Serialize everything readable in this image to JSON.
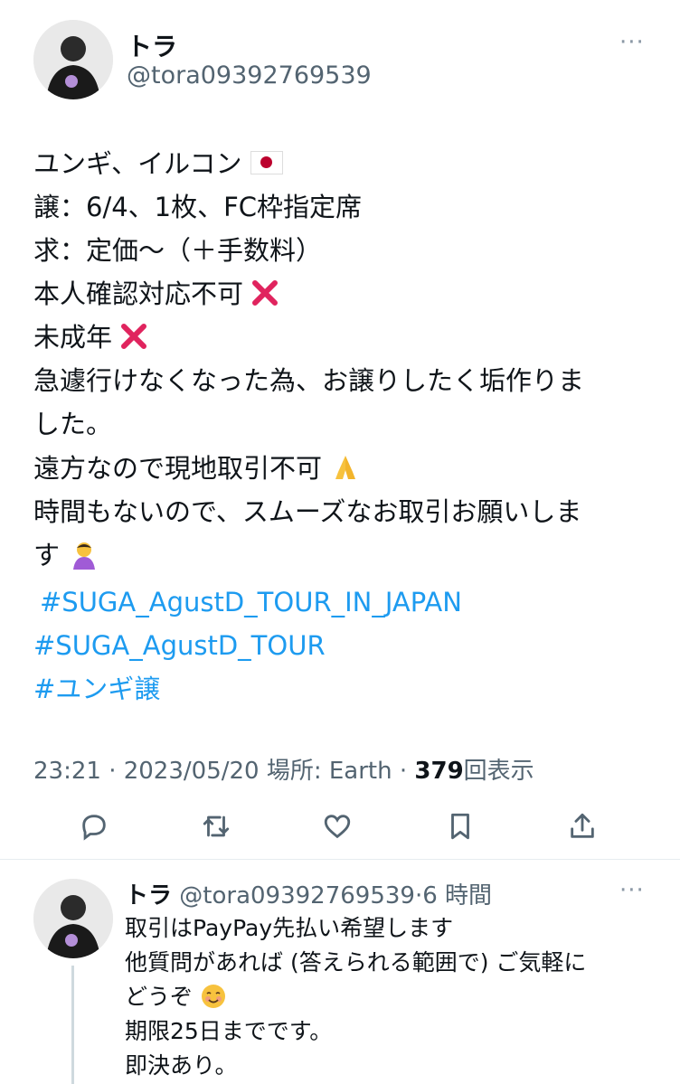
{
  "tweet": {
    "display_name": "トラ",
    "handle": "@tora09392769539",
    "lines": [
      "ユンギ、イルコン",
      "譲：6/4、1枚、FC枠指定席",
      "求：定価〜（＋手数料）",
      "本人確認対応不可",
      "未成年",
      "急遽行けなくなった為、お譲りしたく垢作りま",
      "した。",
      "遠方なので現地取引不可",
      "時間もないので、スムーズなお取引お願いしま",
      "す"
    ],
    "hashtags": [
      "#SUGA_AgustD_TOUR_IN_JAPAN",
      "#SUGA_AgustD_TOUR",
      "#ユンギ譲"
    ],
    "meta_prefix": "23:21 · 2023/05/20 場所: Earth · ",
    "view_count": "379",
    "view_suffix": "回表示"
  },
  "actions": {
    "icons": [
      "reply-icon",
      "retweet-icon",
      "like-icon",
      "bookmark-icon",
      "share-icon"
    ]
  },
  "reply": {
    "display_name": "トラ",
    "handle": "@tora09392769539",
    "time": "·6 時間",
    "lines": [
      "取引はPayPay先払い希望します",
      "他質問があれば (答えられる範囲で) ご気軽に",
      "どうぞ",
      "期限25日までです。",
      "即決あり。"
    ]
  },
  "colors": {
    "accent": "#1d9bf0",
    "muted": "#536471",
    "x_red": "#e0245e"
  }
}
